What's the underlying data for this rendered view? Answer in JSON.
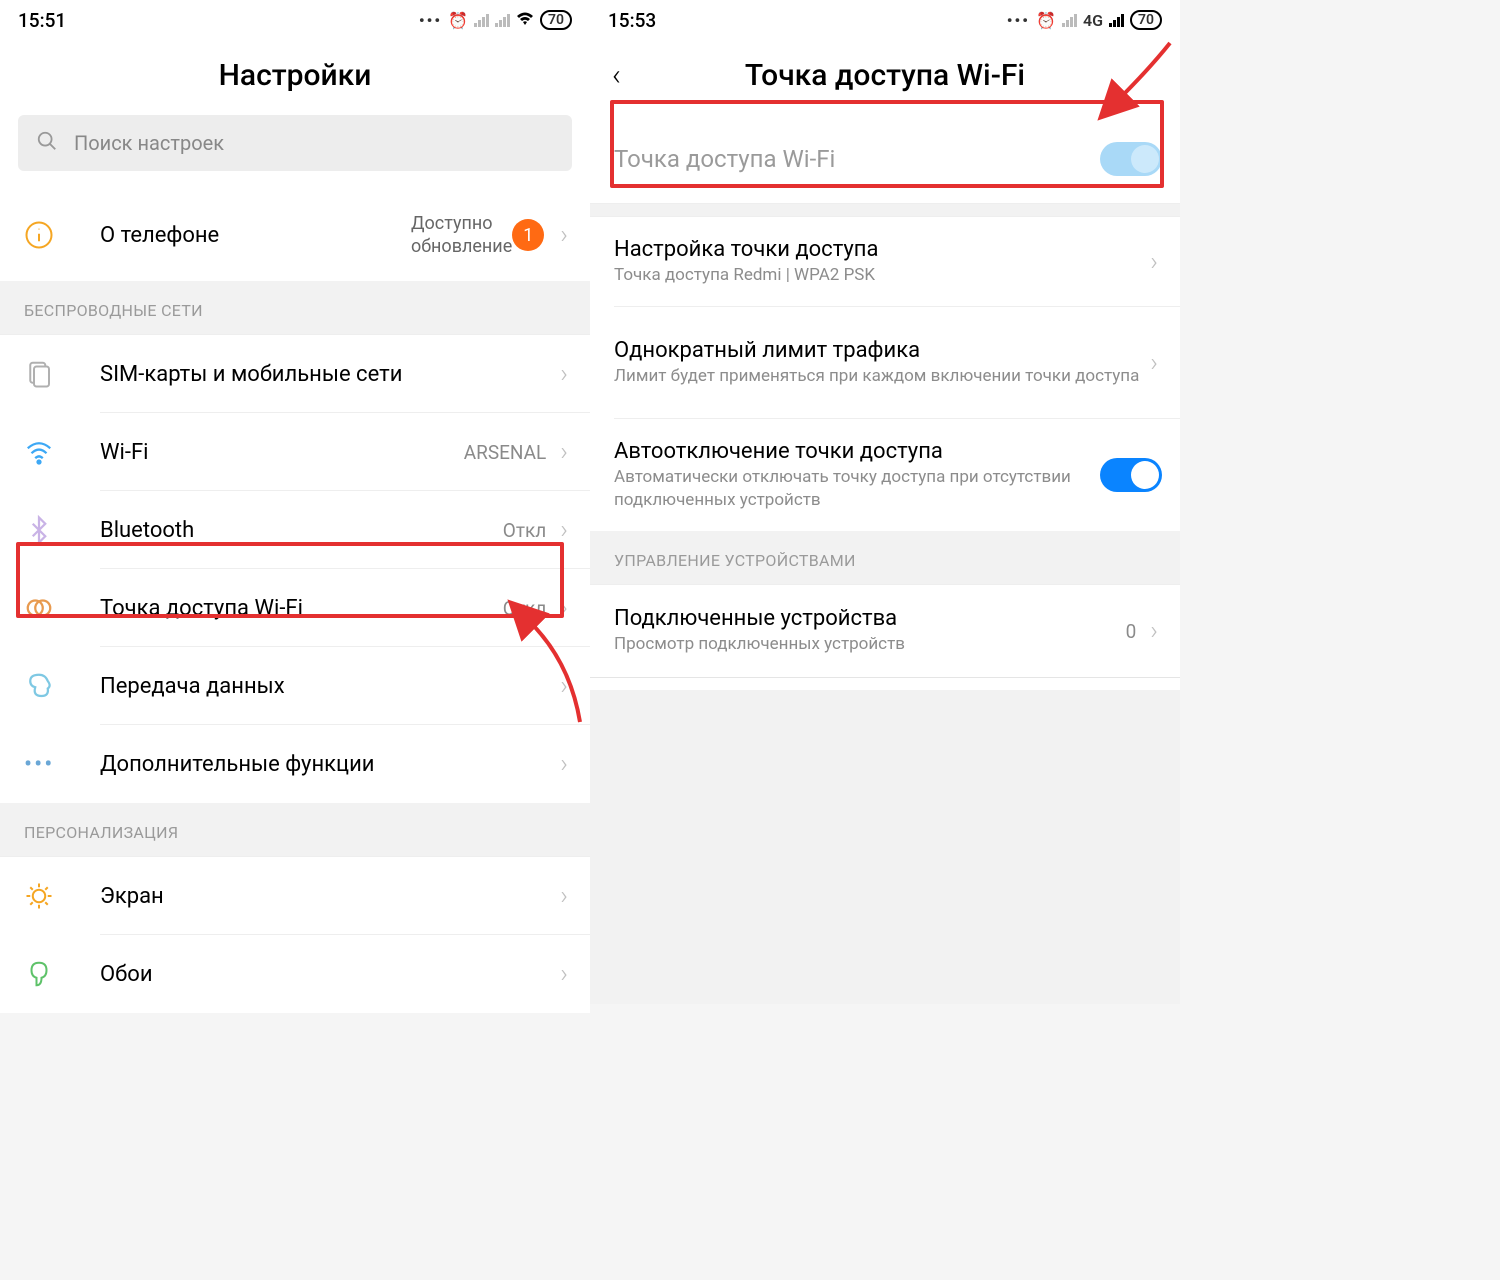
{
  "left": {
    "status": {
      "time": "15:51",
      "battery": "70"
    },
    "header": "Настройки",
    "search_placeholder": "Поиск настроек",
    "about": {
      "title": "О телефоне",
      "sub1": "Доступно",
      "sub2": "обновление",
      "badge": "1"
    },
    "section_wireless": "БЕСПРОВОДНЫЕ СЕТИ",
    "items": {
      "sim": "SIM-карты и мобильные сети",
      "wifi": "Wi-Fi",
      "wifi_value": "ARSENAL",
      "bluetooth": "Bluetooth",
      "bluetooth_value": "Откл",
      "hotspot": "Точка доступа Wi-Fi",
      "hotspot_value": "Откл",
      "data": "Передача данных",
      "more": "Дополнительные функции"
    },
    "section_personal": "ПЕРСОНАЛИЗАЦИЯ",
    "personal": {
      "display": "Экран",
      "wallpaper": "Обои"
    }
  },
  "right": {
    "status": {
      "time": "15:53",
      "network": "4G",
      "battery": "70"
    },
    "header": "Точка доступа Wi-Fi",
    "toggle_row": "Точка доступа Wi-Fi",
    "setup": {
      "title": "Настройка точки доступа",
      "sub": "Точка доступа Redmi | WPA2 PSK"
    },
    "limit": {
      "title": "Однократный лимит трафика",
      "sub": "Лимит будет применяться при каждом включении точки доступа"
    },
    "auto_off": {
      "title": "Автоотключение точки доступа",
      "sub": "Автоматически отключать точку доступа при отсутствии подключенных устройств"
    },
    "section_devices": "УПРАВЛЕНИЕ УСТРОЙСТВАМИ",
    "devices": {
      "title": "Подключенные устройства",
      "sub": "Просмотр подключенных устройств",
      "count": "0"
    }
  }
}
